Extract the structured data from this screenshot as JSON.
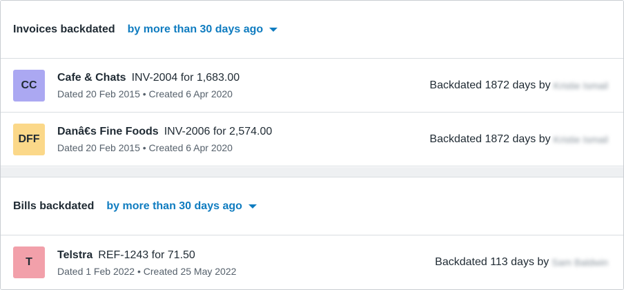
{
  "invoices": {
    "title": "Invoices backdated",
    "filter": "by more than 30 days ago",
    "rows": [
      {
        "initials": "CC",
        "avatar_color": "#aba8f2",
        "name": "Cafe & Chats",
        "ref": "INV-2004 for 1,683.00",
        "dated": "Dated 20 Feb 2015 • Created 6 Apr 2020",
        "backdated": "Backdated 1872 days by",
        "user": "Kristie Ismail"
      },
      {
        "initials": "DFF",
        "avatar_color": "#fbd889",
        "name": "Danâ€s Fine Foods",
        "ref": "INV-2006 for 2,574.00",
        "dated": "Dated 20 Feb 2015 • Created 6 Apr 2020",
        "backdated": "Backdated 1872 days by",
        "user": "Kristie Ismail"
      }
    ]
  },
  "bills": {
    "title": "Bills backdated",
    "filter": "by more than 30 days ago",
    "rows": [
      {
        "initials": "T",
        "avatar_color": "#f2a0aa",
        "name": "Telstra",
        "ref": "REF-1243 for 71.50",
        "dated": "Dated 1 Feb 2022 • Created 25 May 2022",
        "backdated": "Backdated 113 days by",
        "user": "Sam Baldwin"
      }
    ]
  },
  "colors": {
    "link": "#0f7cc0",
    "separator": "#eef0f2"
  }
}
